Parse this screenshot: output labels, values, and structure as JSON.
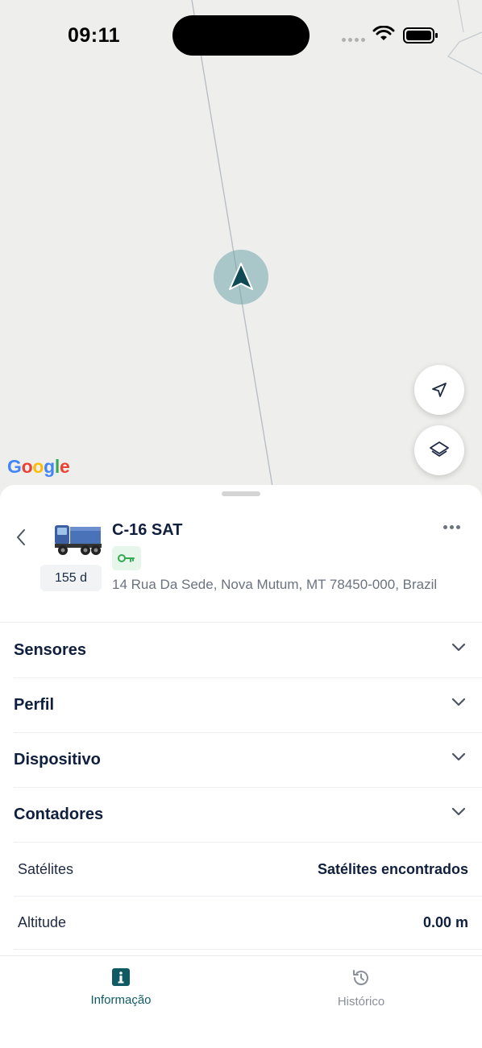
{
  "status_bar": {
    "time": "09:11"
  },
  "map": {
    "attribution": "Google"
  },
  "unit": {
    "name": "C-16 SAT",
    "days": "155 d",
    "address": "14 Rua Da Sede, Nova Mutum, MT 78450-000, Brazil"
  },
  "sections": [
    {
      "label": "Sensores"
    },
    {
      "label": "Perfil"
    },
    {
      "label": "Dispositivo"
    },
    {
      "label": "Contadores"
    }
  ],
  "rows": [
    {
      "key": "Satélites",
      "value": "Satélites encontrados"
    },
    {
      "key": "Altitude",
      "value": "0.00 m"
    }
  ],
  "tabs": [
    {
      "label": "Informação",
      "icon": "info-icon",
      "active": true
    },
    {
      "label": "Histórico",
      "icon": "history-icon",
      "active": false
    }
  ],
  "colors": {
    "accent": "#0f5a63",
    "key_green": "#34a853",
    "marker": "#0f5a63"
  }
}
